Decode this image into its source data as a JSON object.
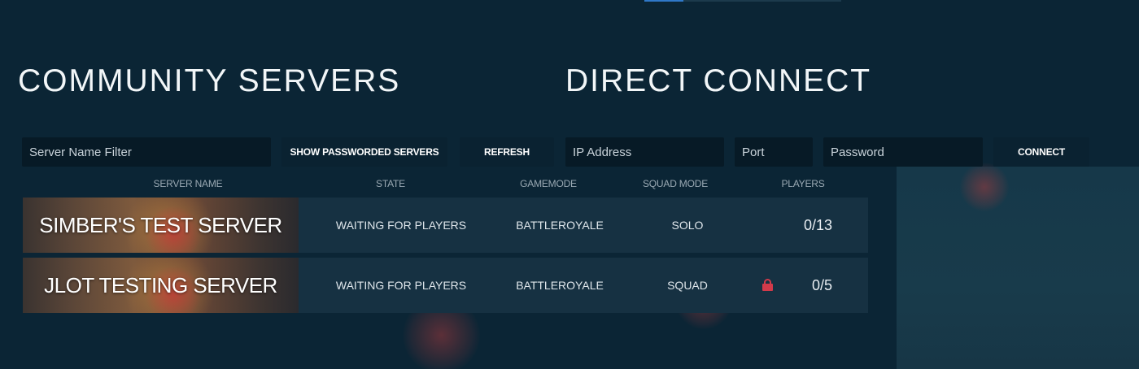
{
  "sections": {
    "community_title": "COMMUNITY SERVERS",
    "direct_title": "DIRECT CONNECT"
  },
  "filters": {
    "server_name_placeholder": "Server Name Filter",
    "show_passworded_label": "SHOW PASSWORDED SERVERS",
    "refresh_label": "REFRESH"
  },
  "direct_connect": {
    "ip_placeholder": "IP Address",
    "port_placeholder": "Port",
    "password_placeholder": "Password",
    "connect_label": "CONNECT"
  },
  "table": {
    "columns": [
      "SERVER NAME",
      "STATE",
      "GAMEMODE",
      "SQUAD MODE",
      "PLAYERS"
    ],
    "rows": [
      {
        "name": "SIMBER'S TEST SERVER",
        "state": "WAITING FOR PLAYERS",
        "gamemode": "BATTLEROYALE",
        "squad_mode": "SOLO",
        "locked": false,
        "players": "0/13"
      },
      {
        "name": "JLOT TESTING SERVER",
        "state": "WAITING FOR PLAYERS",
        "gamemode": "BATTLEROYALE",
        "squad_mode": "SQUAD",
        "locked": true,
        "lock_icon": "lock-icon",
        "players": "0/5"
      }
    ]
  },
  "colors": {
    "background": "#0b2535",
    "input_bg": "#071a26",
    "row_bg": "#163142",
    "lock": "#d23a4a",
    "tab_indicator": "#2f78c8"
  }
}
